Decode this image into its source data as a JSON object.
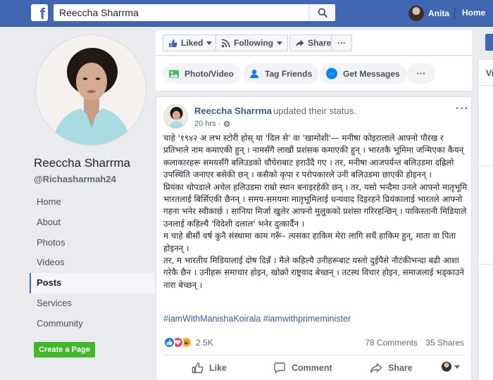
{
  "topbar": {
    "search_value": "Reeccha Sharrma",
    "user_name": "Anita",
    "home_label": "Home"
  },
  "profile": {
    "name": "Reeccha Sharrma",
    "handle": "@Richasharmah24",
    "nav": [
      {
        "label": "Home"
      },
      {
        "label": "About"
      },
      {
        "label": "Photos"
      },
      {
        "label": "Videos"
      },
      {
        "label": "Posts",
        "active": true
      },
      {
        "label": "Services"
      },
      {
        "label": "Community"
      }
    ],
    "create_page_label": "Create a Page"
  },
  "actions": {
    "liked": "Liked",
    "following": "Following",
    "share": "Share",
    "more": "···"
  },
  "composer": {
    "photo_video": "Photo/Video",
    "tag_friends": "Tag Friends",
    "get_messages": "Get Messages",
    "more": "···"
  },
  "right_panel": {
    "initial": "Vi"
  },
  "post": {
    "author": "Reeccha Sharrma",
    "action": "updated their status.",
    "time": "20 hrs ·",
    "paragraphs": [
      "चाहे '१९४२ अ लभ स्टोरी होस् या 'दिल से' वा 'खामोशी'— मनीषा कोइरालाले आफ्नो पौरख र प्रतिभाले नाम कमाएकी हुन् । नामसँगै लाखौं प्रशंसक कमाएकी हुन् । भारतकै भूमिमा जन्मिएका कैयन् कलाकारहरू समयसँगै बलिउडको चौघेराबाट हराउँदै गए । तर, मनीषा आजपर्यन्त बलिउडमा दह्रिलो उपस्थिति जनाएर बसेकी छन् । कसैको कृपा र परोपकारले उनी बलिउडमा छाएकी होइनन् ।",
      "प्रियंका चोपडाले अचेल हलिउडमा राम्रो स्थान बनाइरहेकी छन् । तर, यसो भन्दैमा उनले आफ्नो मातृभूमि भारतलाई बिर्सिएकी छैनन् । समय-समयमा मातृभूमिलाई धन्यवाद दिइरहने प्रियंकालाई भारतले आफ्नो गहना भनेर स्वीकार्छ । सानिया मिर्जा खुलेर आफ्नो मुलुकको प्रशंसा गरिरहन्छिन् । पाकिस्तानी मिडियाले उनलाई कहिल्यै 'विदेशी दलाल' भनेर दुत्कार्दैन ।",
      "म चाहे बीसौं वर्ष कुनै संस्थामा काम गरूँ– त्यसका हाकिम मेरा लागि सधैं हाकिम हुन्, माता वा पिता होइनन् ।",
      "तर, म भारतीय मिडियालाई दोष दिन्नँ । मैले कहिल्यै उनीहरूबाट यस्तो दुईपैसे नौटंकीभन्दा बढी आशा गरेकै छैन । उनीहरू समाचार होइन, खोक्रो राष्ट्रवाद बेच्छन् । तटस्थ विचार होइन, समाजलाई भड्काउने नारा बेच्छन् ।"
    ],
    "hashtags": [
      "#iamWithManishaKoirala",
      "#iamwithprimeminister"
    ],
    "reactions_count": "2.5K",
    "comments": "78 Comments",
    "shares": "35 Shares",
    "like_label": "Like",
    "comment_label": "Comment",
    "share_label": "Share"
  },
  "colors": {
    "facebook_blue": "#4267b2",
    "link_blue": "#365899",
    "create_green": "#42b72a",
    "like_reaction": "#2078f4",
    "love_reaction": "#f33e58",
    "haha_reaction": "#f7b125"
  }
}
